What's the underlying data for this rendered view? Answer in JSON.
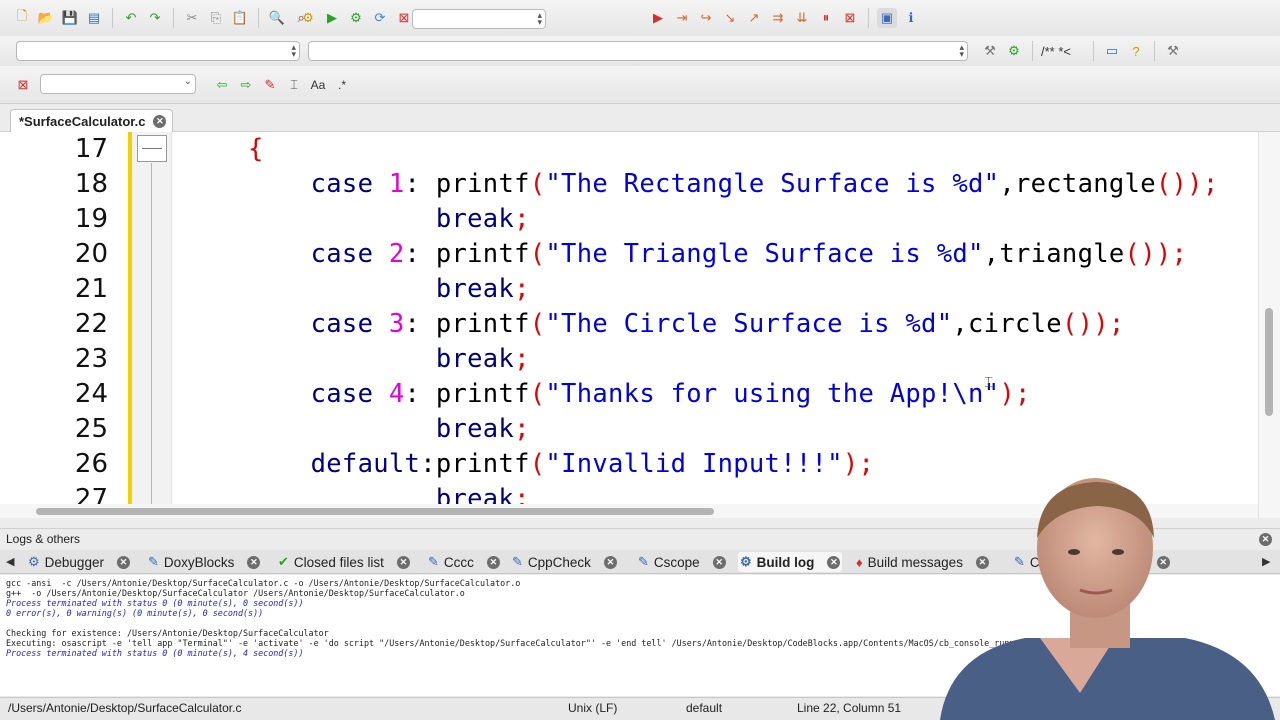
{
  "toolbar": {
    "icons_row1": [
      "new-file-icon",
      "open-icon",
      "save-icon",
      "save-all-icon",
      "undo-icon",
      "redo-icon",
      "cut-icon",
      "copy-icon",
      "paste-icon",
      "find-icon",
      "replace-icon",
      "build-icon",
      "run-icon",
      "build-run-icon",
      "rebuild-icon",
      "abort-icon"
    ],
    "debug_icons": [
      "debug-icon",
      "run-to-cursor-icon",
      "next-line-icon",
      "step-into-icon",
      "step-out-icon",
      "next-instruction-icon",
      "step-into-instruction-icon",
      "break-icon",
      "stop-debug-icon",
      "debug-windows-icon",
      "info-icon"
    ],
    "build_target": "",
    "scope_combo": "",
    "function_combo": "",
    "doxy_label": "/** *<",
    "search_value": "",
    "regex_label": ".*",
    "aa_label": "Aa"
  },
  "editor": {
    "tab_label": "*SurfaceCalculator.c",
    "lines": [
      {
        "num": "17",
        "tokens": [
          {
            "t": "{",
            "c": "br"
          }
        ]
      },
      {
        "num": "18",
        "tokens": [
          {
            "t": "    case ",
            "c": "kw"
          },
          {
            "t": "1",
            "c": "num"
          },
          {
            "t": ": printf",
            "c": ""
          },
          {
            "t": "(",
            "c": "br"
          },
          {
            "t": "\"The Rectangle Surface is %d\"",
            "c": "str"
          },
          {
            "t": ",rectangle",
            "c": ""
          },
          {
            "t": "())",
            "c": "br"
          },
          {
            "t": ";",
            "c": "br"
          }
        ]
      },
      {
        "num": "19",
        "tokens": [
          {
            "t": "            break",
            "c": "kw"
          },
          {
            "t": ";",
            "c": "br"
          }
        ]
      },
      {
        "num": "20",
        "tokens": [
          {
            "t": "    case ",
            "c": "kw"
          },
          {
            "t": "2",
            "c": "num"
          },
          {
            "t": ": printf",
            "c": ""
          },
          {
            "t": "(",
            "c": "br"
          },
          {
            "t": "\"The Triangle Surface is %d\"",
            "c": "str"
          },
          {
            "t": ",triangle",
            "c": ""
          },
          {
            "t": "())",
            "c": "br"
          },
          {
            "t": ";",
            "c": "br"
          }
        ]
      },
      {
        "num": "21",
        "tokens": [
          {
            "t": "            break",
            "c": "kw"
          },
          {
            "t": ";",
            "c": "br"
          }
        ]
      },
      {
        "num": "22",
        "tokens": [
          {
            "t": "    case ",
            "c": "kw"
          },
          {
            "t": "3",
            "c": "num"
          },
          {
            "t": ": printf",
            "c": ""
          },
          {
            "t": "(",
            "c": "br"
          },
          {
            "t": "\"The Circle Surface is %d\"",
            "c": "str"
          },
          {
            "t": ",circle",
            "c": ""
          },
          {
            "t": "())",
            "c": "br"
          },
          {
            "t": ";",
            "c": "br"
          }
        ]
      },
      {
        "num": "23",
        "tokens": [
          {
            "t": "            break",
            "c": "kw"
          },
          {
            "t": ";",
            "c": "br"
          }
        ]
      },
      {
        "num": "24",
        "tokens": [
          {
            "t": "    case ",
            "c": "kw"
          },
          {
            "t": "4",
            "c": "num"
          },
          {
            "t": ": printf",
            "c": ""
          },
          {
            "t": "(",
            "c": "br"
          },
          {
            "t": "\"Thanks for using the App!\\n\"",
            "c": "str"
          },
          {
            "t": ")",
            "c": "br"
          },
          {
            "t": ";",
            "c": "br"
          }
        ]
      },
      {
        "num": "25",
        "tokens": [
          {
            "t": "            break",
            "c": "kw"
          },
          {
            "t": ";",
            "c": "br"
          }
        ]
      },
      {
        "num": "26",
        "tokens": [
          {
            "t": "    default",
            "c": "kw"
          },
          {
            "t": ":printf",
            "c": ""
          },
          {
            "t": "(",
            "c": "br"
          },
          {
            "t": "\"Invallid Input!!!\"",
            "c": "str"
          },
          {
            "t": ")",
            "c": "br"
          },
          {
            "t": ";",
            "c": "br"
          }
        ]
      },
      {
        "num": "27",
        "tokens": [
          {
            "t": "            break",
            "c": "kw"
          },
          {
            "t": ";",
            "c": "br"
          }
        ]
      }
    ]
  },
  "logs": {
    "header": "Logs & others",
    "tabs": [
      {
        "label": "Debugger",
        "icon": "debugger-icon",
        "glyph": "⚙",
        "active": false
      },
      {
        "label": "DoxyBlocks",
        "icon": "doxyblocks-icon",
        "glyph": "✎",
        "active": false
      },
      {
        "label": "Closed files list",
        "icon": "closed-files-icon",
        "glyph": "✔",
        "active": false
      },
      {
        "label": "Cccc",
        "icon": "cccc-icon",
        "glyph": "✎",
        "active": false
      },
      {
        "label": "CppCheck",
        "icon": "cppcheck-icon",
        "glyph": "✎",
        "active": false
      },
      {
        "label": "Cscope",
        "icon": "cscope-icon",
        "glyph": "✎",
        "active": false
      },
      {
        "label": "Build log",
        "icon": "build-log-icon",
        "glyph": "⚙",
        "active": true
      },
      {
        "label": "Build messages",
        "icon": "build-messages-icon",
        "glyph": "♦",
        "active": false
      },
      {
        "label": "C",
        "icon": "code-icon",
        "glyph": "✎",
        "active": false
      },
      {
        "label": "ges",
        "icon": "",
        "glyph": "",
        "active": false
      }
    ],
    "lines": [
      {
        "text": "gcc -ansi  -c /Users/Antonie/Desktop/SurfaceCalculator.c -o /Users/Antonie/Desktop/SurfaceCalculator.o",
        "blue": false
      },
      {
        "text": "g++  -o /Users/Antonie/Desktop/SurfaceCalculator /Users/Antonie/Desktop/SurfaceCalculator.o",
        "blue": false
      },
      {
        "text": "Process terminated with status 0 (0 minute(s), 0 second(s))",
        "blue": true
      },
      {
        "text": "0 error(s), 0 warning(s) (0 minute(s), 0 second(s))",
        "blue": true
      },
      {
        "text": "",
        "blue": false
      },
      {
        "text": "Checking for existence: /Users/Antonie/Desktop/SurfaceCalculator",
        "blue": false
      },
      {
        "text": "Executing: osascript -e 'tell app \"Terminal\"' -e 'activate' -e 'do script \"/Users/Antonie/Desktop/SurfaceCalculator\"' -e 'end tell' /Users/Antonie/Desktop/CodeBlocks.app/Contents/MacOS/cb_console_runner  (in /Users/Ant",
        "blue": false
      },
      {
        "text": "Process terminated with status 0 (0 minute(s), 4 second(s))",
        "blue": true
      }
    ]
  },
  "status": {
    "path": "/Users/Antonie/Desktop/SurfaceCalculator.c",
    "eol": "Unix (LF)",
    "encoding": "default",
    "position": "Line 22, Column 51"
  }
}
